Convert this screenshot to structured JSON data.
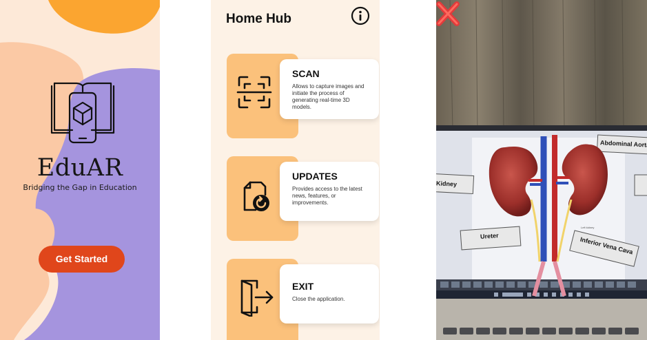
{
  "splash": {
    "brand_name": "EduAR",
    "tagline": "Bridging the Gap in Education",
    "cta_label": "Get Started",
    "colors": {
      "background": "#fde9d8",
      "orange": "#fba530",
      "purple": "#a594de",
      "peach": "#fbc9a5",
      "cta": "#e0461b"
    }
  },
  "hub": {
    "title": "Home Hub",
    "cards": [
      {
        "title": "SCAN",
        "description": "Allows to capture images and initiate the process of generating real-time 3D models.",
        "icon": "scan-icon"
      },
      {
        "title": "UPDATES",
        "description": "Provides access to the latest news, features, or improvements.",
        "icon": "updates-icon"
      },
      {
        "title": "EXIT",
        "description": "Close the application.",
        "icon": "exit-icon"
      }
    ],
    "colors": {
      "background": "#fdf2e6",
      "panel": "#fbc17b"
    }
  },
  "ar_view": {
    "labels": {
      "kidney": "Kidney",
      "abdominal_aorta": "Abdominal Aorta",
      "ureter": "Ureter",
      "inferior_vena_cava": "Inferior Vena Cava",
      "left_kidney": "Left kidney"
    },
    "close_icon": "close-icon"
  }
}
